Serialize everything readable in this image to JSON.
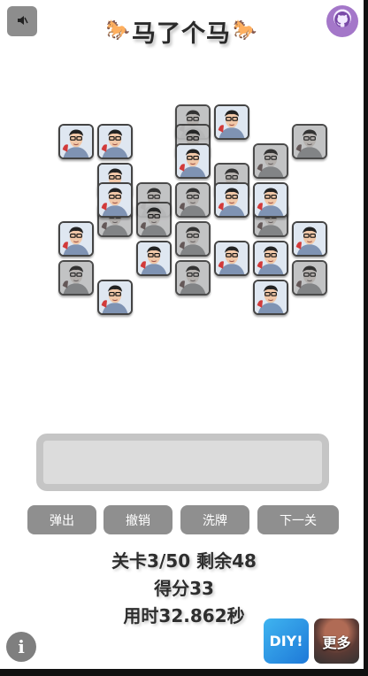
{
  "header": {
    "title": "马了个马",
    "left_emoji": "🐎",
    "right_emoji": "🐎",
    "sound_icon": "speaker-icon",
    "github_icon": "github-icon"
  },
  "board": {
    "tile_icon": "face-photo-icon",
    "tiles": [
      {
        "row": 0,
        "col": 3,
        "state": "blocked"
      },
      {
        "row": 0,
        "col": 4,
        "state": "active"
      },
      {
        "row": 1,
        "col": 0,
        "state": "active"
      },
      {
        "row": 1,
        "col": 1,
        "state": "active"
      },
      {
        "row": 1,
        "col": 3,
        "state": "blocked"
      },
      {
        "row": 1,
        "col": 6,
        "state": "blocked"
      },
      {
        "row": 2,
        "col": 3,
        "state": "active"
      },
      {
        "row": 2,
        "col": 5,
        "state": "blocked"
      },
      {
        "row": 3,
        "col": 1,
        "state": "active"
      },
      {
        "row": 3,
        "col": 4,
        "state": "blocked"
      },
      {
        "row": 4,
        "col": 1,
        "state": "active"
      },
      {
        "row": 4,
        "col": 2,
        "state": "blocked"
      },
      {
        "row": 4,
        "col": 3,
        "state": "blocked"
      },
      {
        "row": 4,
        "col": 4,
        "state": "active"
      },
      {
        "row": 4,
        "col": 5,
        "state": "active"
      },
      {
        "row": 5,
        "col": 1,
        "state": "blocked"
      },
      {
        "row": 5,
        "col": 2,
        "state": "blocked"
      },
      {
        "row": 5,
        "col": 5,
        "state": "blocked"
      },
      {
        "row": 6,
        "col": 0,
        "state": "active"
      },
      {
        "row": 6,
        "col": 3,
        "state": "blocked"
      },
      {
        "row": 6,
        "col": 6,
        "state": "active"
      },
      {
        "row": 7,
        "col": 2,
        "state": "active"
      },
      {
        "row": 7,
        "col": 4,
        "state": "active"
      },
      {
        "row": 7,
        "col": 5,
        "state": "active"
      },
      {
        "row": 8,
        "col": 0,
        "state": "blocked"
      },
      {
        "row": 8,
        "col": 3,
        "state": "blocked"
      },
      {
        "row": 8,
        "col": 6,
        "state": "blocked"
      },
      {
        "row": 9,
        "col": 1,
        "state": "active"
      },
      {
        "row": 9,
        "col": 5,
        "state": "active"
      }
    ]
  },
  "tray": {
    "slots_filled": 0
  },
  "actions": {
    "pop_label": "弹出",
    "undo_label": "撤销",
    "shuffle_label": "洗牌",
    "next_label": "下一关"
  },
  "stats": {
    "level_line": "关卡3/50 剩余48",
    "score_line": "得分33",
    "time_line": "用时32.862秒"
  },
  "footer": {
    "info_label": "i",
    "diy_label": "DIY!",
    "more_label": "更多"
  }
}
